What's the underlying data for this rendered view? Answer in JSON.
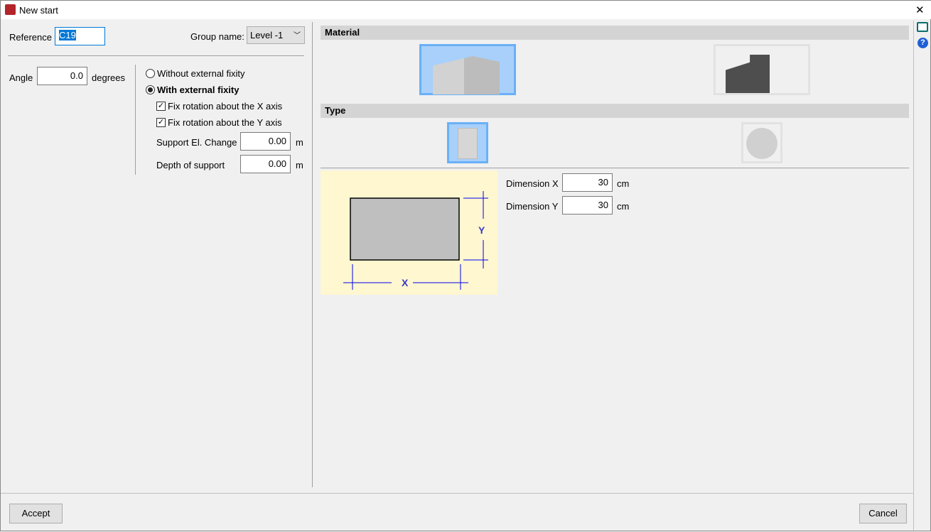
{
  "window": {
    "title": "New start",
    "close": "✕"
  },
  "reference": {
    "label": "Reference",
    "value": "C19"
  },
  "group": {
    "label": "Group name:",
    "value": "Level -1"
  },
  "angle": {
    "label": "Angle",
    "value": "0.0",
    "unit": "degrees"
  },
  "fixity": {
    "without": "Without external fixity",
    "with": "With external fixity",
    "fix_x": "Fix rotation about the X axis",
    "fix_y": "Fix rotation about the Y axis",
    "support_label": "Support El. Change",
    "support_value": "0.00",
    "support_unit": "m",
    "depth_label": "Depth of support",
    "depth_value": "0.00",
    "depth_unit": "m"
  },
  "material": {
    "header": "Material"
  },
  "type": {
    "header": "Type"
  },
  "dims": {
    "x_label": "Dimension X",
    "x_value": "30",
    "x_unit": "cm",
    "y_label": "Dimension Y",
    "y_value": "30",
    "y_unit": "cm",
    "diagram_x": "X",
    "diagram_y": "Y"
  },
  "footer": {
    "accept": "Accept",
    "cancel": "Cancel"
  }
}
